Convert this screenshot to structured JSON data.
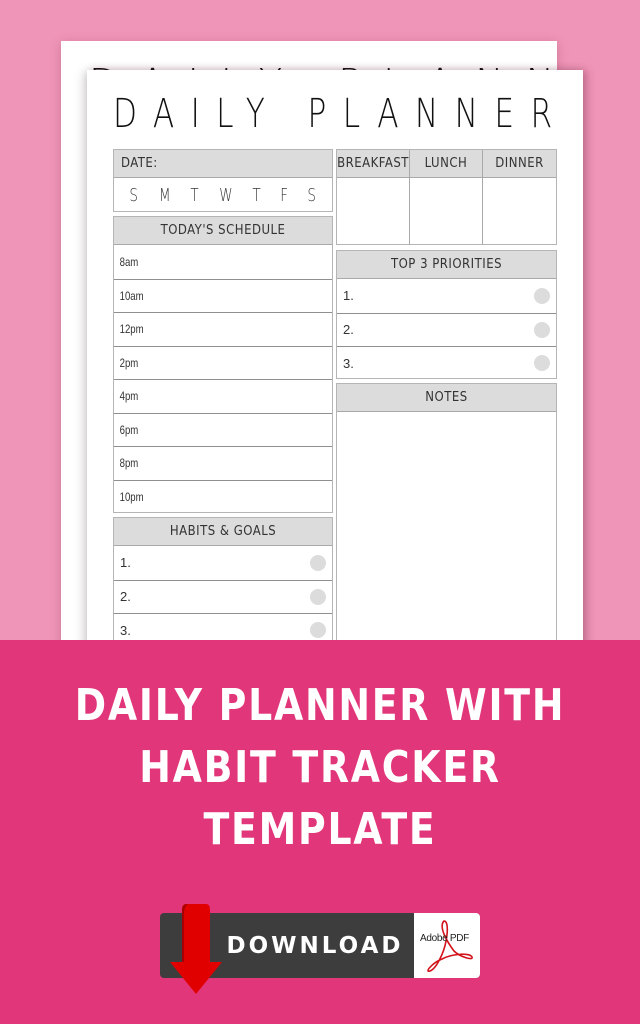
{
  "planner": {
    "title": "DAILY PLANNER",
    "date_label": "DATE:",
    "weekdays": [
      "S",
      "M",
      "T",
      "W",
      "T",
      "F",
      "S"
    ],
    "schedule": {
      "header": "TODAY'S SCHEDULE",
      "times": [
        "8am",
        "10am",
        "12pm",
        "2pm",
        "4pm",
        "6pm",
        "8pm",
        "10pm"
      ]
    },
    "habits": {
      "header": "HABITS & GOALS",
      "items": [
        "1.",
        "2.",
        "3."
      ]
    },
    "meals": {
      "headers": [
        "BREAKFAST",
        "LUNCH",
        "DINNER"
      ]
    },
    "priorities": {
      "header": "TOP 3 PRIORITIES",
      "items": [
        "1.",
        "2.",
        "3."
      ]
    },
    "notes": {
      "header": "NOTES"
    }
  },
  "banner": {
    "headline_lines": [
      "DAILY PLANNER WITH",
      "HABIT TRACKER",
      "TEMPLATE"
    ],
    "download_label": "DOWNLOAD",
    "pdf_badge_label": "Adobe PDF",
    "icons": {
      "download": "download-arrow-icon",
      "pdf": "adobe-pdf-icon"
    }
  },
  "colors": {
    "background_pink": "#ef95b7",
    "band_pink": "#e2367a",
    "header_gray": "#dcdcdc",
    "button_dark": "#3d3d3d",
    "arrow_red": "#e00000"
  }
}
